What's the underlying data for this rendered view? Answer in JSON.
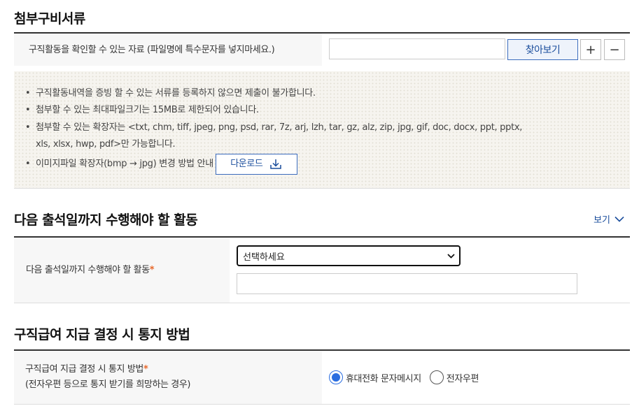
{
  "attach": {
    "title": "첨부구비서류",
    "row_label": "구직활동을 확인할 수 있는 자료 (파일명에 특수문자를 넣지마세요.)",
    "file_value": "",
    "browse_label": "찾아보기",
    "add_label": "+",
    "remove_label": "−",
    "notices": [
      "구직활동내역을 증빙 할 수 있는 서류를 등록하지 않으면 제출이 불가합니다.",
      "첨부할 수 있는 최대파일크기는 15MB로 제한되어 있습니다.",
      "첨부할 수 있는 확장자는 <txt, chm, tiff, jpeg, png, psd, rar, 7z, arj, lzh, tar, gz, alz, zip, jpg, gif, doc, docx, ppt, pptx,"
    ],
    "notice_cont": "xls, xlsx, hwp, pdf>만 가능합니다.",
    "image_notice": "이미지파일 확장자(bmp → jpg) 변경 방법 안내",
    "download_label": "다운로드"
  },
  "activity": {
    "title": "다음 출석일까지 수행해야 할 활동",
    "view_label": "보기",
    "field_label": "다음 출석일까지 수행해야 할 활동",
    "required_mark": "*",
    "select_value": "선택하세요",
    "text_value": ""
  },
  "notify": {
    "title": "구직급여 지급 결정 시 통지 방법",
    "field_label": "구직급여 지급 결정 시 통지 방법",
    "required_mark": "*",
    "field_sub": "(전자우편 등으로 통지 받기를 희망하는 경우)",
    "options": [
      "휴대전화 문자메시지",
      "전자우편"
    ],
    "selected": "휴대전화 문자메시지"
  },
  "colors": {
    "accent": "#1a4d9c",
    "required": "#e8692c",
    "radio": "#2a6de0"
  }
}
